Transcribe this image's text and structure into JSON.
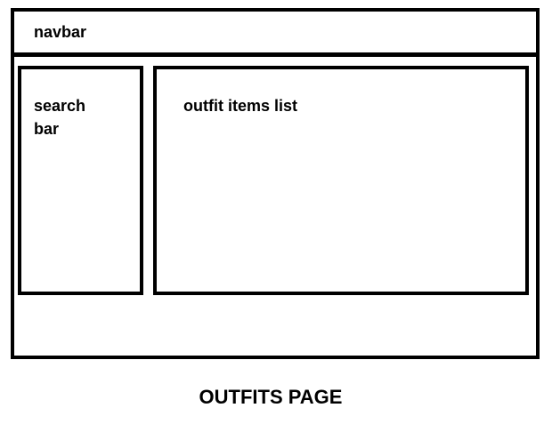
{
  "wireframe": {
    "navbar": {
      "label": "navbar"
    },
    "search_panel": {
      "label": "search bar"
    },
    "outfit_list_panel": {
      "label": "outfit items list"
    },
    "caption": "OUTFITS PAGE"
  },
  "colors": {
    "stroke": "#000000",
    "background": "#ffffff",
    "text": "#000000"
  }
}
